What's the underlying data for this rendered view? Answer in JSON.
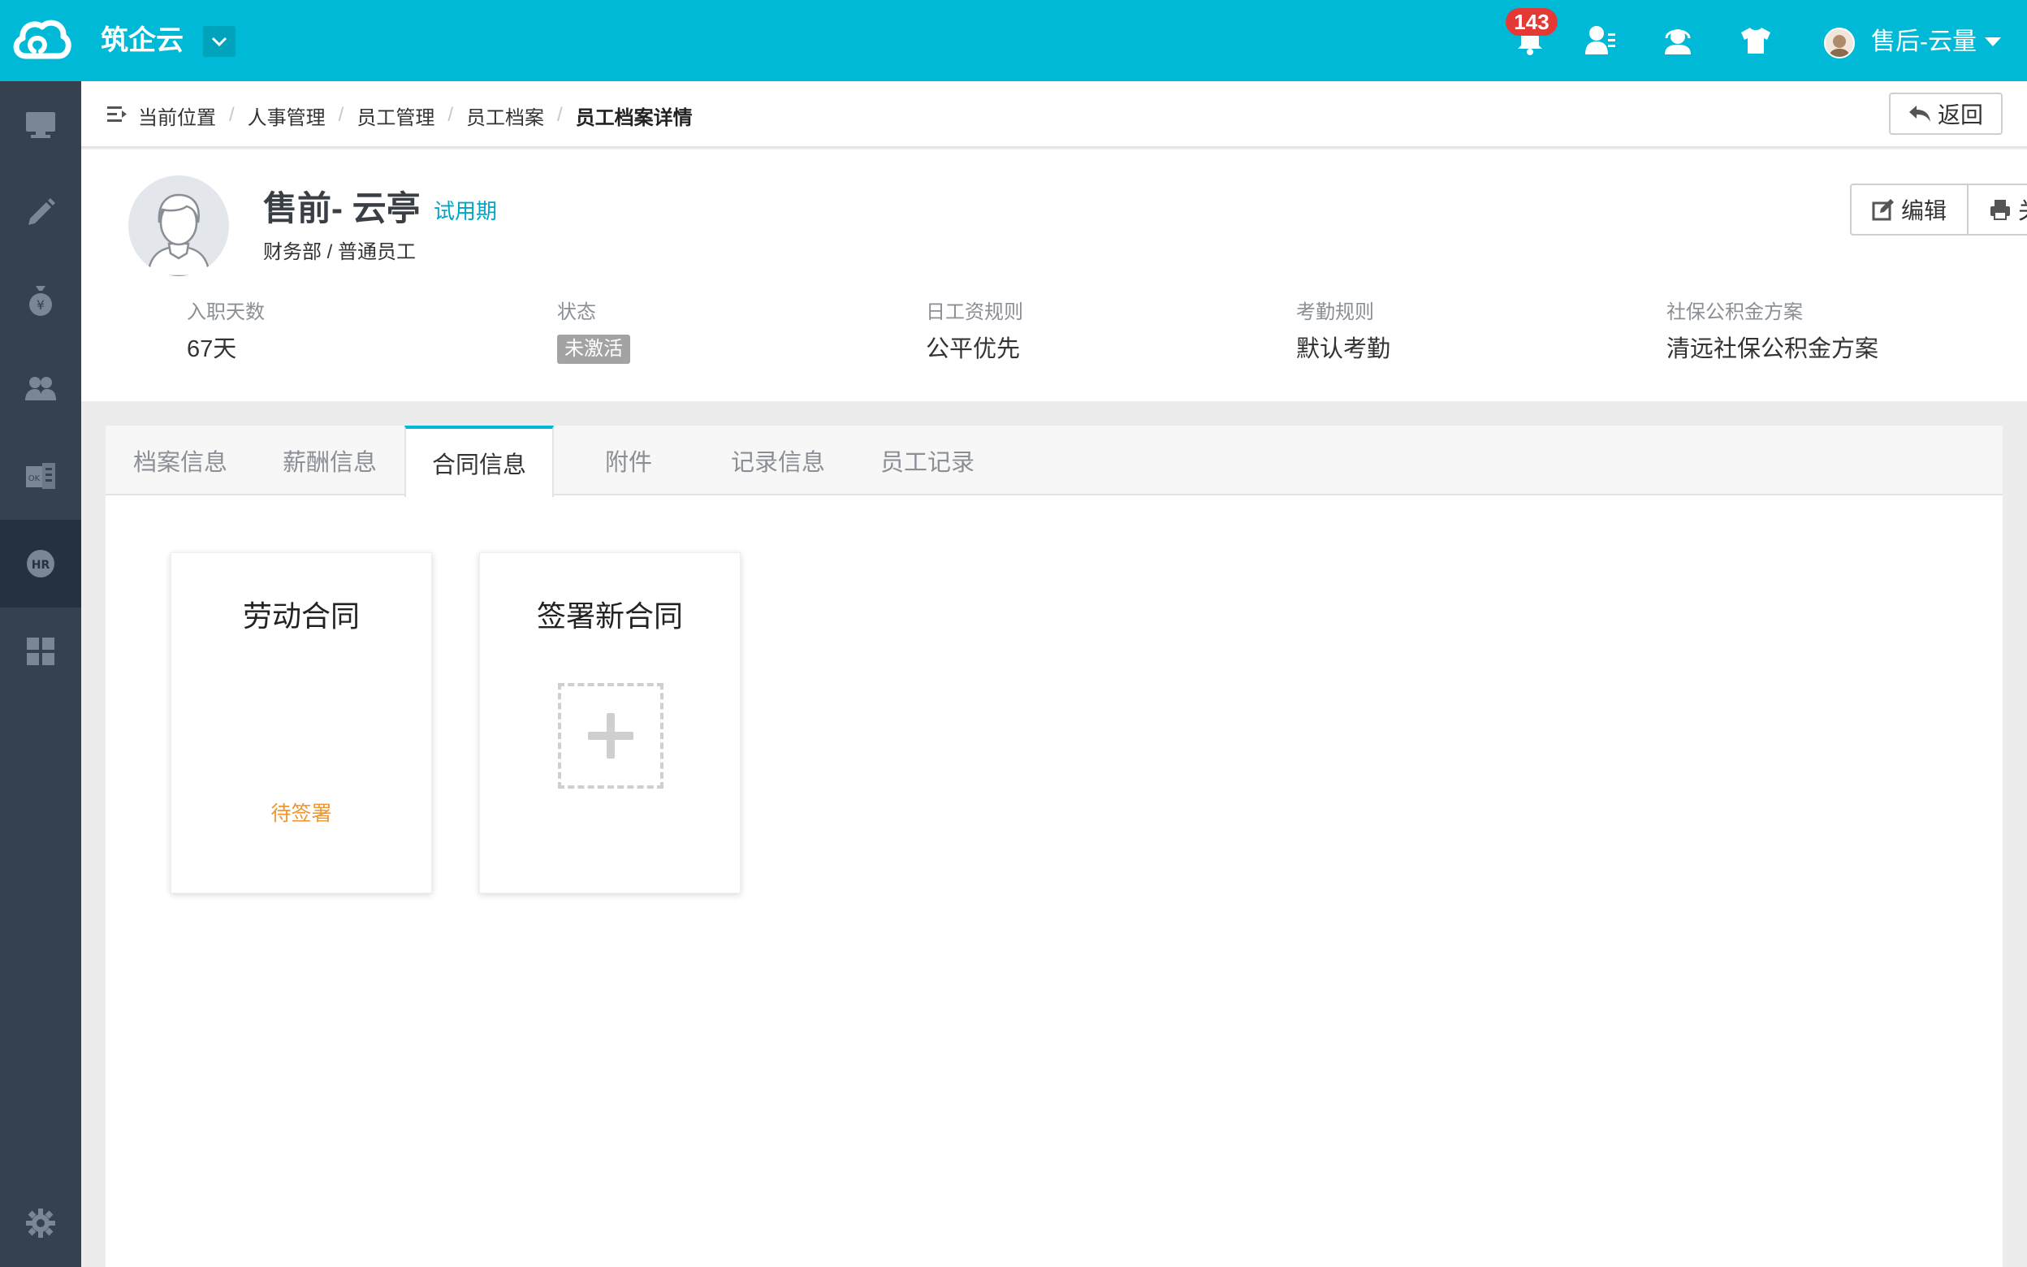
{
  "app": {
    "title": "筑企云"
  },
  "topbar": {
    "notification_count": "143",
    "user_name": "售后-云量"
  },
  "sidebar": {
    "items": [
      {
        "icon": "monitor-icon"
      },
      {
        "icon": "pencil-icon"
      },
      {
        "icon": "money-bag-icon"
      },
      {
        "icon": "users-icon"
      },
      {
        "icon": "ok-book-icon"
      },
      {
        "icon": "hr-icon",
        "active": true
      },
      {
        "icon": "grid-icon"
      }
    ],
    "bottom_icon": "gear-icon"
  },
  "breadcrumb": {
    "items": [
      "当前位置",
      "人事管理",
      "员工管理",
      "员工档案",
      "员工档案详情"
    ],
    "back_label": "返回"
  },
  "profile": {
    "name": "售前- 云亭",
    "status_badge": "试用期",
    "department": "财务部 / 普通员工",
    "edit_label": "编辑",
    "close_label": "关闭",
    "stats": [
      {
        "label": "入职天数",
        "value": "67天"
      },
      {
        "label": "状态",
        "value": "未激活"
      },
      {
        "label": "日工资规则",
        "value": "公平优先"
      },
      {
        "label": "考勤规则",
        "value": "默认考勤"
      },
      {
        "label": "社保公积金方案",
        "value": "清远社保公积金方案"
      }
    ]
  },
  "tabs": [
    "档案信息",
    "薪酬信息",
    "合同信息",
    "附件",
    "记录信息",
    "员工记录"
  ],
  "active_tab": "合同信息",
  "contracts": {
    "card1": {
      "title": "劳动合同",
      "status": "待签署"
    },
    "card2": {
      "title": "签署新合同"
    }
  },
  "colors": {
    "topbar": "#00b9d6",
    "sidebar": "#35414f",
    "accent": "#00b9d6",
    "pending": "#f0962e",
    "badge": "#e53935"
  }
}
